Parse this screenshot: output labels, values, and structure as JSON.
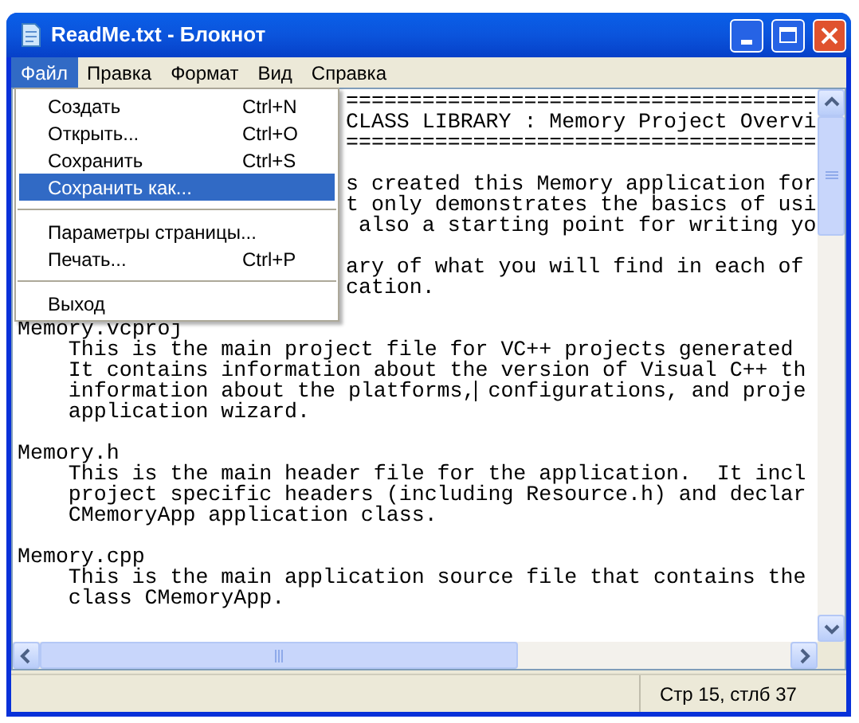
{
  "window": {
    "title": "ReadMe.txt - Блокнот"
  },
  "menu_bar": [
    {
      "label": "Файл",
      "selected": true
    },
    {
      "label": "Правка",
      "selected": false
    },
    {
      "label": "Формат",
      "selected": false
    },
    {
      "label": "Вид",
      "selected": false
    },
    {
      "label": "Справка",
      "selected": false
    }
  ],
  "file_menu": [
    {
      "kind": "item",
      "label": "Создать",
      "shortcut": "Ctrl+N",
      "selected": false
    },
    {
      "kind": "item",
      "label": "Открыть...",
      "shortcut": "Ctrl+O",
      "selected": false
    },
    {
      "kind": "item",
      "label": "Сохранить",
      "shortcut": "Ctrl+S",
      "selected": false
    },
    {
      "kind": "item",
      "label": "Сохранить как...",
      "selected": true
    },
    {
      "kind": "separator"
    },
    {
      "kind": "item",
      "label": "Параметры страницы...",
      "selected": false
    },
    {
      "kind": "item",
      "label": "Печать...",
      "shortcut": "Ctrl+P",
      "selected": false
    },
    {
      "kind": "separator"
    },
    {
      "kind": "item",
      "label": "Выход",
      "selected": false
    }
  ],
  "editor_lines": [
    {
      "kind": "covered",
      "text": "====================================="
    },
    {
      "kind": "covered",
      "text": "CLASS LIBRARY : Memory Project Overvi"
    },
    {
      "kind": "covered",
      "text": "====================================="
    },
    {
      "kind": "blank"
    },
    {
      "kind": "covered",
      "text": "s created this Memory application for"
    },
    {
      "kind": "covered",
      "text": "t only demonstrates the basics of usi"
    },
    {
      "kind": "covered",
      "text": " also a starting point for writing yo"
    },
    {
      "kind": "blank"
    },
    {
      "kind": "covered",
      "text": "ary of what you will find in each of"
    },
    {
      "kind": "covered",
      "text": "cation."
    },
    {
      "kind": "blank"
    },
    {
      "kind": "heading",
      "text": "Memory.vcproj"
    },
    {
      "kind": "body",
      "text": "This is the main project file for VC++ projects generated"
    },
    {
      "kind": "body",
      "text": "It contains information about the version of Visual C++ th"
    },
    {
      "kind": "body",
      "text": "information about the platforms,",
      "text_after_cursor": " configurations, and proje"
    },
    {
      "kind": "body",
      "text": "application wizard."
    },
    {
      "kind": "blank"
    },
    {
      "kind": "heading",
      "text": "Memory.h"
    },
    {
      "kind": "body",
      "text": "This is the main header file for the application.  It incl"
    },
    {
      "kind": "body",
      "text": "project specific headers (including Resource.h) and declar"
    },
    {
      "kind": "body",
      "text": "CMemoryApp application class."
    },
    {
      "kind": "blank"
    },
    {
      "kind": "heading",
      "text": "Memory.cpp"
    },
    {
      "kind": "body",
      "text": "This is the main application source file that contains the"
    },
    {
      "kind": "body",
      "text": "class CMemoryApp."
    }
  ],
  "status_bar": {
    "position": "Стр 15, стлб 37"
  }
}
